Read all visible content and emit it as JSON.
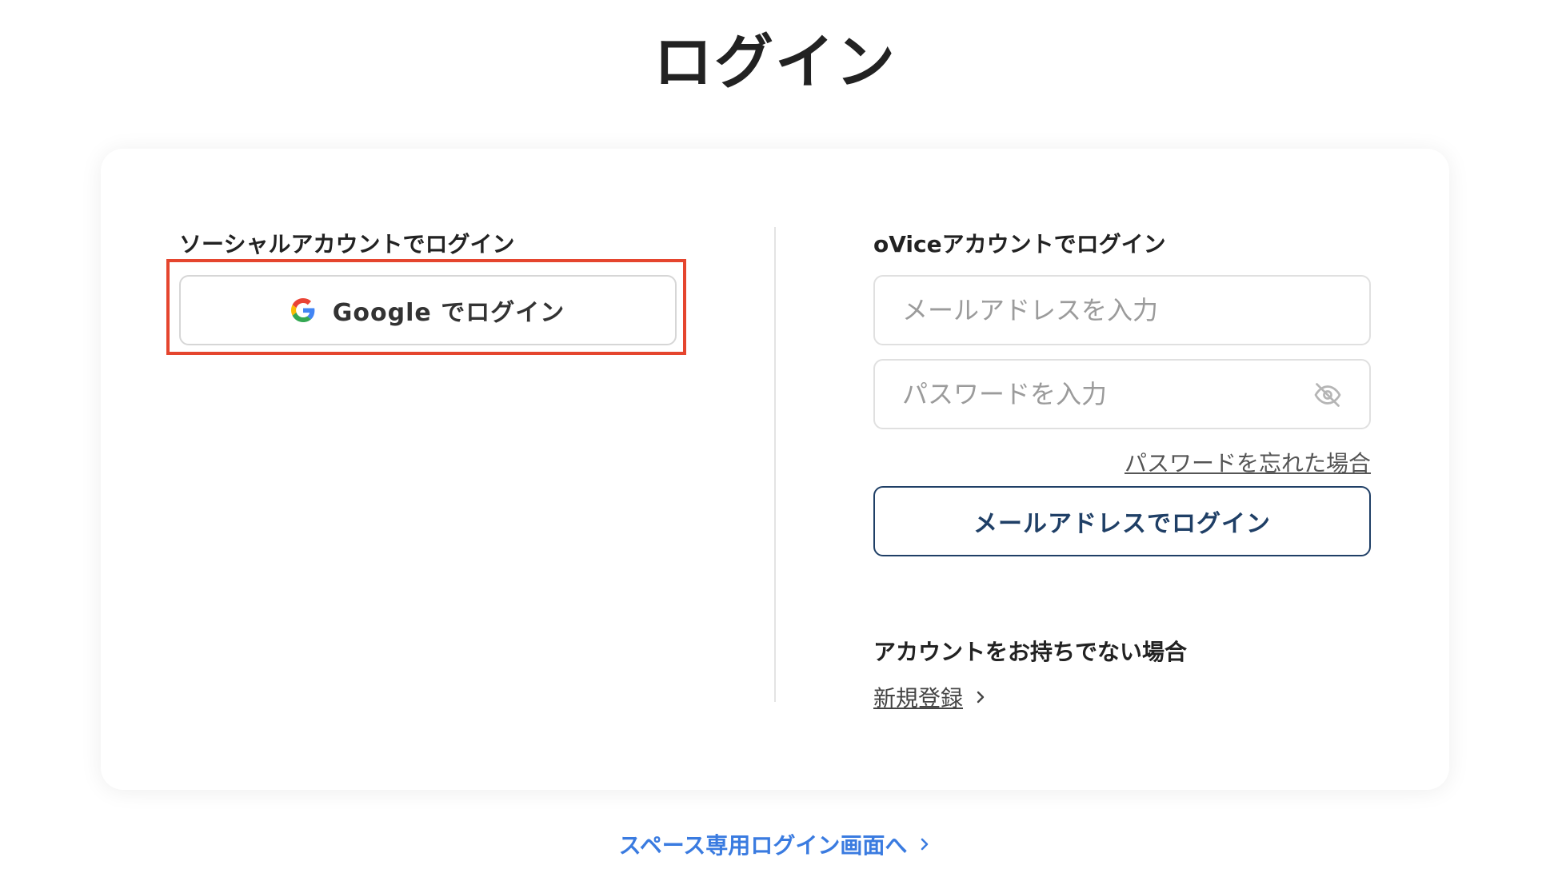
{
  "page": {
    "title": "ログイン"
  },
  "social": {
    "heading": "ソーシャルアカウントでログイン",
    "google_button_label": "Google でログイン",
    "google_icon": "google-g-icon",
    "highlight_color": "#e5452e"
  },
  "ovice": {
    "heading": "oViceアカウントでログイン",
    "email_placeholder": "メールアドレスを入力",
    "email_value": "",
    "password_placeholder": "パスワードを入力",
    "password_value": "",
    "visibility_icon": "eye-off-icon",
    "forgot_password": "パスワードを忘れた場合",
    "email_login_button": "メールアドレスでログイン",
    "accent_color": "#1f3f66"
  },
  "signup": {
    "heading": "アカウントをお持ちでない場合",
    "link": "新規登録",
    "icon": "chevron-right-icon"
  },
  "footer": {
    "space_login_link": "スペース専用ログイン画面へ",
    "link_color": "#3a7be0",
    "icon": "chevron-right-icon"
  }
}
